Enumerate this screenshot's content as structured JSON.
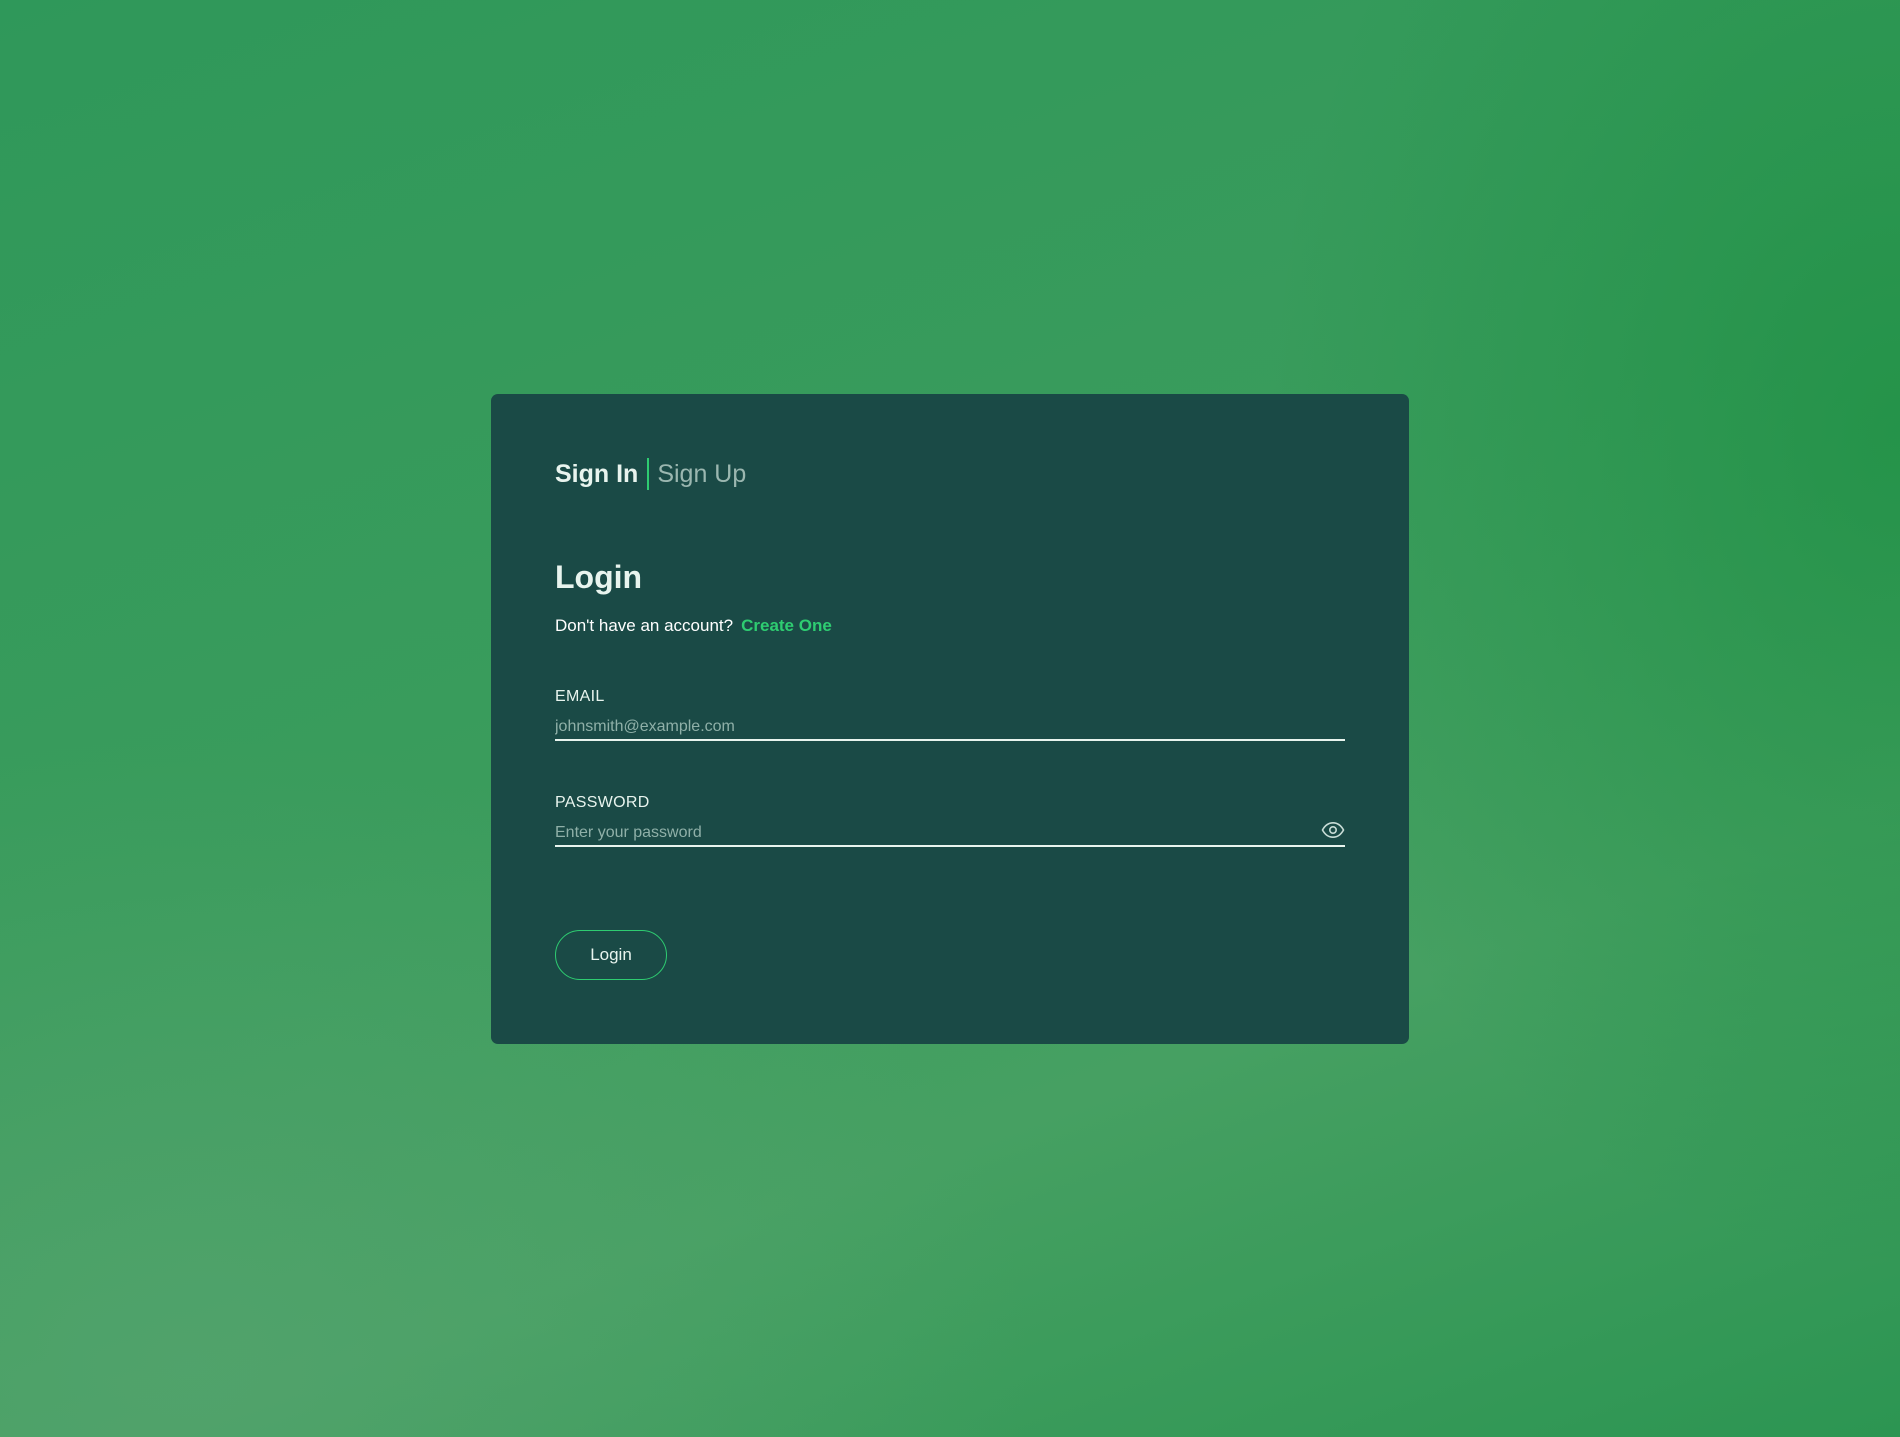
{
  "tabs": {
    "sign_in": "Sign In",
    "sign_up": "Sign Up"
  },
  "form": {
    "title": "Login",
    "no_account_text": "Don't have an account?",
    "create_link": "Create One",
    "email": {
      "label": "EMAIL",
      "placeholder": "johnsmith@example.com",
      "value": ""
    },
    "password": {
      "label": "PASSWORD",
      "placeholder": "Enter your password",
      "value": "",
      "toggle_icon": "eye-icon"
    },
    "submit_label": "Login"
  },
  "colors": {
    "card_background": "#1a4a46",
    "accent": "#2ecc71",
    "page_background": "#3a9c5c"
  }
}
